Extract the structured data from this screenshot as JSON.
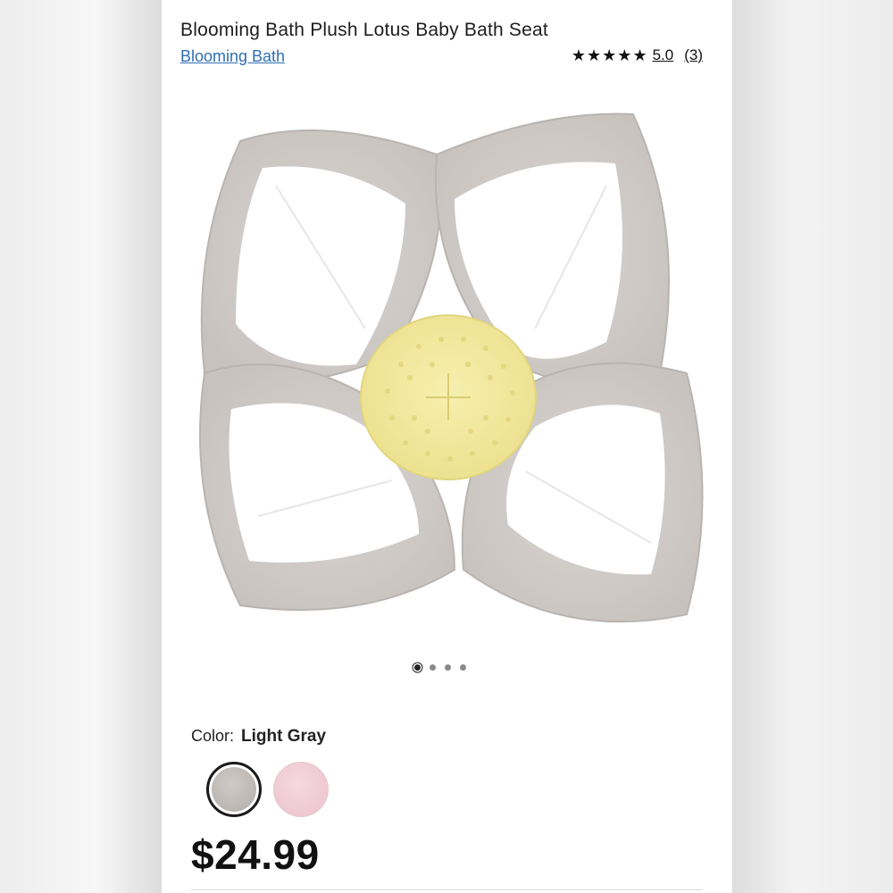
{
  "product": {
    "title": "Blooming Bath Plush Lotus Baby Bath Seat",
    "brand": "Blooming Bath",
    "rating": {
      "stars": 5,
      "star_glyph": "★",
      "score": "5.0",
      "count": "(3)"
    }
  },
  "carousel": {
    "total": 4,
    "active_index": 0
  },
  "color": {
    "label": "Color:",
    "selected": "Light Gray",
    "swatches": [
      {
        "name": "Light Gray",
        "hex": "#bdb8b4",
        "selected": true
      },
      {
        "name": "Pink",
        "hex": "#efcbd5",
        "selected": false
      }
    ]
  },
  "price": "$24.99"
}
